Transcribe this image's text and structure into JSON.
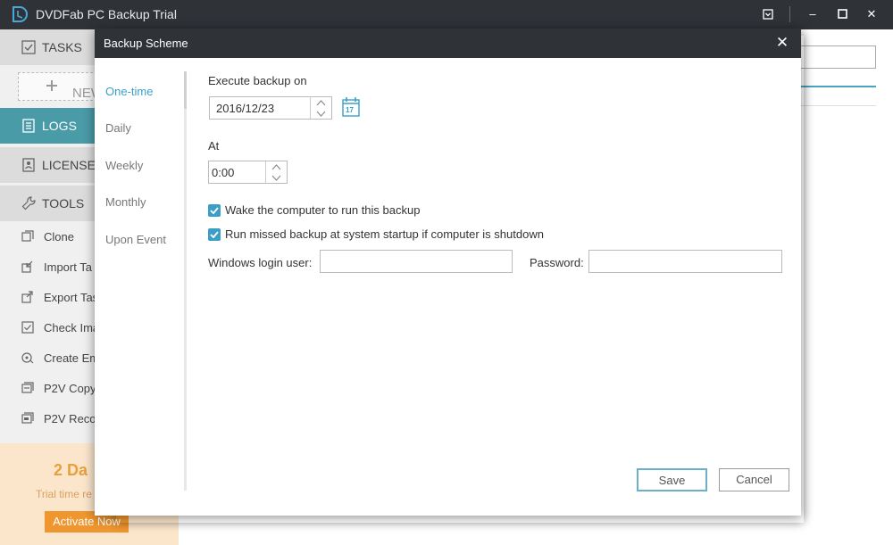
{
  "window": {
    "title": "DVDFab PC Backup Trial",
    "controls": {
      "menu_icon": "menu-icon",
      "minimize": "–",
      "maximize": "▢",
      "close": "✕"
    }
  },
  "sidebar": {
    "tasks_label": "TASKS",
    "new_label": "NEW",
    "logs_label": "LOGS",
    "license_label": "LICENSE",
    "tools_label": "TOOLS",
    "tools": [
      {
        "label": "Clone",
        "icon": "clone-icon"
      },
      {
        "label": "Import Ta",
        "icon": "import-icon"
      },
      {
        "label": "Export Tas",
        "icon": "export-icon"
      },
      {
        "label": "Check Ima",
        "icon": "check-icon"
      },
      {
        "label": "Create Em",
        "icon": "create-icon"
      },
      {
        "label": "P2V Copy",
        "icon": "p2v-copy-icon"
      },
      {
        "label": "P2V Reco",
        "icon": "p2v-recover-icon"
      }
    ],
    "trial": {
      "days": "2 Da",
      "text": "Trial time re",
      "activate_label": "Activate Now"
    }
  },
  "dialog": {
    "title": "Backup Scheme",
    "close_glyph": "✕",
    "nav": [
      {
        "label": "One-time",
        "active": true
      },
      {
        "label": "Daily",
        "active": false
      },
      {
        "label": "Weekly",
        "active": false
      },
      {
        "label": "Monthly",
        "active": false
      },
      {
        "label": "Upon Event",
        "active": false
      }
    ],
    "execute_label": "Execute backup on",
    "date_value": "2016/12/23",
    "calendar_day": "17",
    "at_label": "At",
    "time_value": "0:00",
    "wake_label": "Wake the computer to run this backup",
    "wake_checked": true,
    "missed_label": "Run missed backup at system startup if computer is shutdown",
    "missed_checked": true,
    "login_user_label": "Windows login user:",
    "login_user_value": "",
    "password_label": "Password:",
    "password_value": "",
    "save_label": "Save",
    "cancel_label": "Cancel"
  },
  "colors": {
    "titlebar": "#2f3338",
    "accent": "#3aa0c8",
    "active_nav": "#4a9ba8",
    "trial_bg": "#fbe6cc",
    "activate_btn": "#f0962e"
  }
}
